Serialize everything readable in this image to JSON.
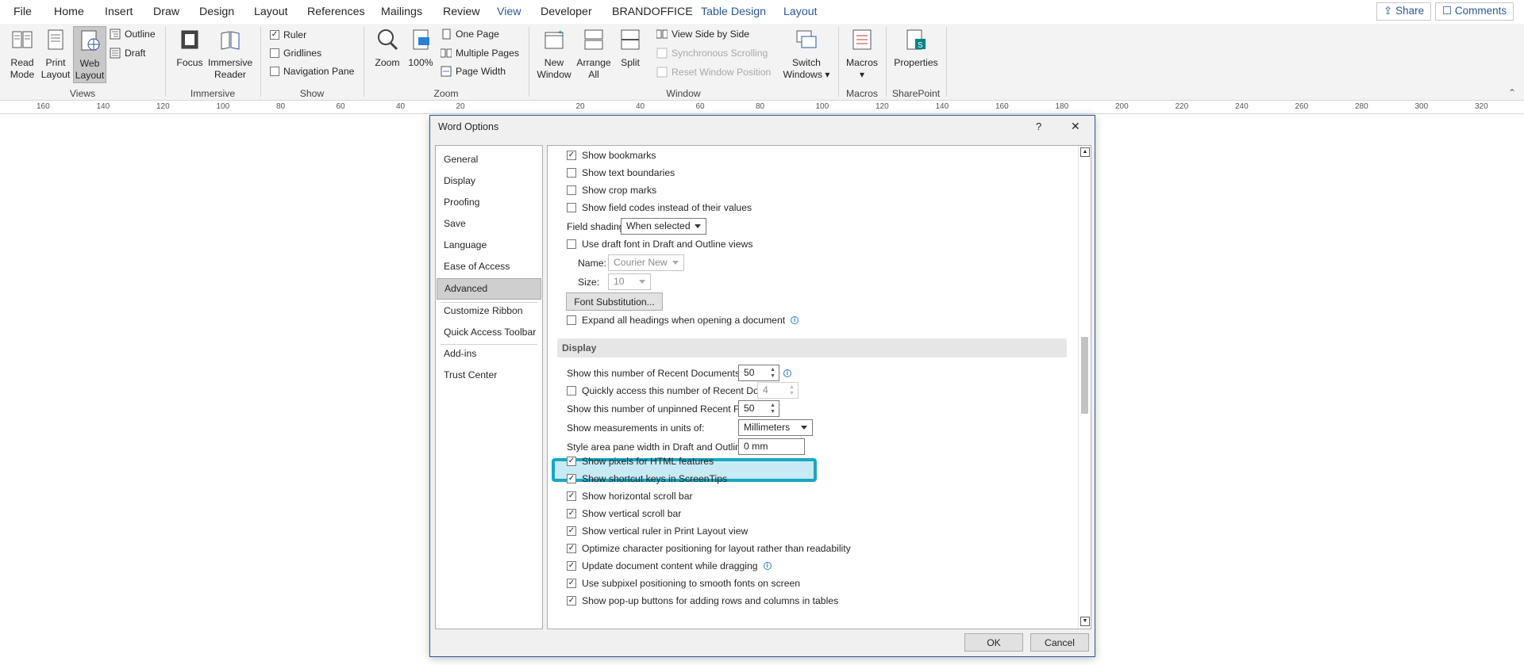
{
  "tabs": [
    "File",
    "Home",
    "Insert",
    "Draw",
    "Design",
    "Layout",
    "References",
    "Mailings",
    "Review",
    "View",
    "Developer",
    "BRANDOFFICE",
    "Table Design",
    "Layout"
  ],
  "active_tab": "View",
  "top_right": {
    "share": "Share",
    "comments": "Comments"
  },
  "ribbon": {
    "views": {
      "read_mode": [
        "Read",
        "Mode"
      ],
      "print_layout": [
        "Print",
        "Layout"
      ],
      "web_layout": [
        "Web",
        "Layout"
      ],
      "outline": "Outline",
      "draft": "Draft",
      "label": "Views"
    },
    "immersive": {
      "focus": "Focus",
      "immersive_reader": [
        "Immersive",
        "Reader"
      ],
      "label": "Immersive"
    },
    "show": {
      "ruler": "Ruler",
      "gridlines": "Gridlines",
      "navigation_pane": "Navigation Pane",
      "label": "Show",
      "ruler_checked": true
    },
    "zoom": {
      "zoom": "Zoom",
      "hundred": "100%",
      "one_page": "One Page",
      "multiple_pages": "Multiple Pages",
      "page_width": "Page Width",
      "label": "Zoom"
    },
    "window": {
      "new_window": [
        "New",
        "Window"
      ],
      "arrange_all": [
        "Arrange",
        "All"
      ],
      "split": "Split",
      "view_side_by_side": "View Side by Side",
      "synchronous_scrolling": "Synchronous Scrolling",
      "reset_window_position": "Reset Window Position",
      "switch_windows": [
        "Switch",
        "Windows"
      ],
      "label": "Window"
    },
    "macros": {
      "macros": "Macros",
      "label": "Macros"
    },
    "sharepoint": {
      "properties": "Properties",
      "label": "SharePoint"
    }
  },
  "ruler_ticks": [
    "160",
    "140",
    "120",
    "100",
    "80",
    "60",
    "40",
    "20",
    "",
    "20",
    "40",
    "60",
    "80",
    "100",
    "120",
    "140",
    "160",
    "180",
    "200",
    "220",
    "240",
    "260",
    "280",
    "300",
    "320"
  ],
  "dialog": {
    "title": "Word Options",
    "help": "?",
    "close": "✕",
    "nav": [
      "General",
      "Display",
      "Proofing",
      "Save",
      "Language",
      "Ease of Access",
      "Advanced",
      "Customize Ribbon",
      "Quick Access Toolbar",
      "Add-ins",
      "Trust Center"
    ],
    "nav_selected": "Advanced",
    "options_top": [
      {
        "label": "Show bookmarks",
        "checked": true
      },
      {
        "label": "Show text boundaries",
        "checked": false
      },
      {
        "label": "Show crop marks",
        "checked": false
      },
      {
        "label": "Show field codes instead of their values",
        "checked": false
      }
    ],
    "field_shading": {
      "label": "Field shading:",
      "value": "When selected"
    },
    "draft_font": {
      "label": "Use draft font in Draft and Outline views",
      "checked": false
    },
    "name": {
      "label": "Name:",
      "value": "Courier New"
    },
    "size": {
      "label": "Size:",
      "value": "10"
    },
    "font_substitution": "Font Substitution...",
    "expand_headings": {
      "label": "Expand all headings when opening a document",
      "checked": false
    },
    "display_section": "Display",
    "recent_docs": {
      "label": "Show this number of Recent Documents:",
      "value": "50"
    },
    "quick_access": {
      "label": "Quickly access this number of Recent Documents:",
      "value": "4",
      "checked": false
    },
    "recent_folders": {
      "label": "Show this number of unpinned Recent Folders:",
      "value": "50"
    },
    "measurements": {
      "label": "Show measurements in units of:",
      "value": "Millimeters"
    },
    "style_area": {
      "label": "Style area pane width in Draft and Outline views:",
      "value": "0 mm"
    },
    "options_bottom": [
      {
        "label": "Show pixels for HTML features",
        "checked": true
      },
      {
        "label": "Show shortcut keys in ScreenTips",
        "checked": true
      },
      {
        "label": "Show horizontal scroll bar",
        "checked": true
      },
      {
        "label": "Show vertical scroll bar",
        "checked": true
      },
      {
        "label": "Show vertical ruler in Print Layout view",
        "checked": true
      },
      {
        "label": "Optimize character positioning for layout rather than readability",
        "checked": true
      },
      {
        "label": "Update document content while dragging",
        "checked": true
      },
      {
        "label": "Use subpixel positioning to smooth fonts on screen",
        "checked": true
      },
      {
        "label": "Show pop-up buttons for adding rows and columns in tables",
        "checked": true
      }
    ],
    "ok": "OK",
    "cancel": "Cancel"
  },
  "colors": {
    "accent": "#2b579a",
    "highlight": "#17a7c4"
  }
}
